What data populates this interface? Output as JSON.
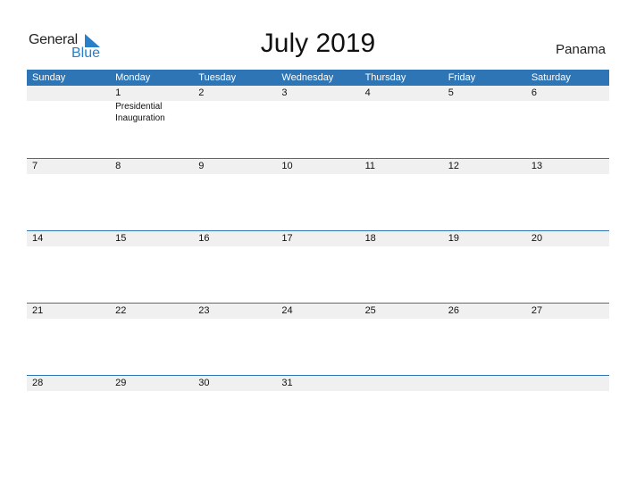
{
  "logo": {
    "word1": "General",
    "word2": "Blue"
  },
  "title": "July 2019",
  "country": "Panama",
  "colors": {
    "accent": "#2e75b6",
    "row_bg": "#f0f0f0",
    "logo_blue": "#2a7fc9"
  },
  "weekdays": [
    "Sunday",
    "Monday",
    "Tuesday",
    "Wednesday",
    "Thursday",
    "Friday",
    "Saturday"
  ],
  "weeks": [
    {
      "days": [
        "",
        "1",
        "2",
        "3",
        "4",
        "5",
        "6"
      ],
      "events": [
        "",
        "Presidential Inauguration",
        "",
        "",
        "",
        "",
        ""
      ]
    },
    {
      "days": [
        "7",
        "8",
        "9",
        "10",
        "11",
        "12",
        "13"
      ],
      "events": [
        "",
        "",
        "",
        "",
        "",
        "",
        ""
      ]
    },
    {
      "days": [
        "14",
        "15",
        "16",
        "17",
        "18",
        "19",
        "20"
      ],
      "events": [
        "",
        "",
        "",
        "",
        "",
        "",
        ""
      ]
    },
    {
      "days": [
        "21",
        "22",
        "23",
        "24",
        "25",
        "26",
        "27"
      ],
      "events": [
        "",
        "",
        "",
        "",
        "",
        "",
        ""
      ]
    },
    {
      "days": [
        "28",
        "29",
        "30",
        "31",
        "",
        "",
        ""
      ],
      "events": [
        "",
        "",
        "",
        "",
        "",
        "",
        ""
      ]
    }
  ]
}
